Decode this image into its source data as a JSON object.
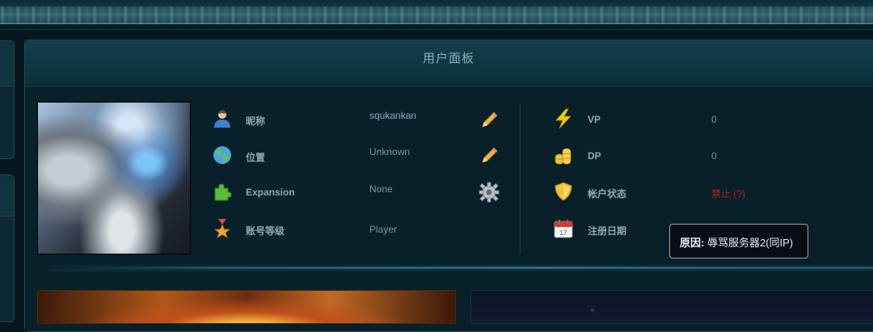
{
  "panel": {
    "title": "用户面板"
  },
  "profile": {
    "rows_left": [
      {
        "icon": "user-icon",
        "label": "昵称",
        "value": "squkankan",
        "action_icon": "pencil-icon"
      },
      {
        "icon": "globe-icon",
        "label": "位置",
        "value": "Unknown",
        "action_icon": "pencil-icon"
      },
      {
        "icon": "puzzle-icon",
        "label": "Expansion",
        "value": "None",
        "action_icon": "gear-icon"
      },
      {
        "icon": "medal-icon",
        "label": "账号等级",
        "value": "Player"
      }
    ],
    "rows_right": [
      {
        "icon": "lightning-icon",
        "label": "VP",
        "value": "0"
      },
      {
        "icon": "coins-icon",
        "label": "DP",
        "value": "0"
      },
      {
        "icon": "shield-icon",
        "label": "帐户状态",
        "value": "禁止 (?)"
      },
      {
        "icon": "calendar-icon",
        "label": "注册日期",
        "value": "",
        "calendar_day": "17"
      }
    ]
  },
  "tooltip": {
    "label": "原因:",
    "text": "辱骂服务器2(同IP)"
  },
  "colors": {
    "status_banned": "#c21d1d",
    "accent": "#7fb0c4"
  }
}
